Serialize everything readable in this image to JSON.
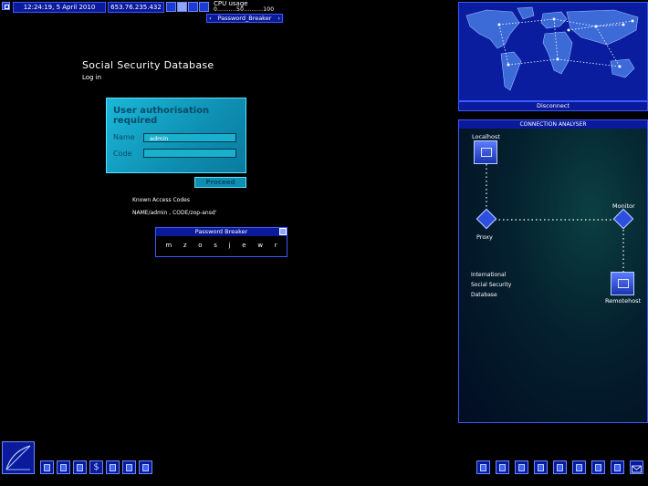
{
  "topbar": {
    "datetime": "12:24:19, 5 April 2010",
    "ip": "653.76.235.432",
    "cpu_label": "CPU usage",
    "cpu_scale": "0..........50..........100",
    "password_breaker_label": "Password_Breaker"
  },
  "login": {
    "title": "Social Security Database",
    "subtitle": "Log in",
    "auth_header": "User authorisation required",
    "name_label": "Name",
    "name_value": "admin",
    "code_label": "Code",
    "code_value": "",
    "proceed_label": "Proceed",
    "known_codes_title": "Known Access Codes",
    "known_codes_value": "NAME/admin , CODE/zop-ansd'"
  },
  "password_breaker": {
    "title": "Password Breaker",
    "letters": [
      "m",
      "z",
      "o",
      "s",
      "j",
      "e",
      "w",
      "r"
    ]
  },
  "map": {
    "disconnect_label": "Disconnect"
  },
  "connection_analyser": {
    "title": "CONNECTION ANALYSER",
    "localhost": "Localhost",
    "proxy": "Proxy",
    "monitor": "Monitor",
    "remotehost": "Remotehost",
    "info_lines": [
      "International",
      "Social Security",
      "Database"
    ]
  },
  "icons": {
    "top": [
      "folder-icon",
      "monitor-icon",
      "file-icon",
      "file-icon"
    ],
    "left": [
      "terminal-icon",
      "window-icon",
      "person-icon",
      "dollar-icon",
      "scanner-icon",
      "gallery-icon",
      "document-icon"
    ],
    "right": [
      "file-icon",
      "file-icon",
      "file-icon",
      "file-icon",
      "file-icon",
      "file-icon",
      "file-icon",
      "file-icon",
      "envelope-icon"
    ]
  },
  "colors": {
    "panel_blue": "#0a1a9a",
    "accent_cyan": "#1bb8d8",
    "border_blue": "#3a5aff"
  }
}
